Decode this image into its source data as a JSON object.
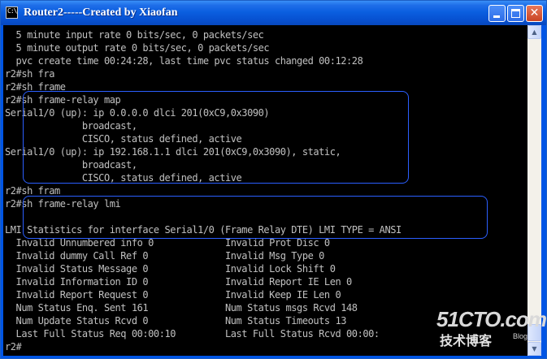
{
  "window": {
    "title": "Router2-----Created by Xiaofan",
    "icon_name": "cmd-icon",
    "icon_text": "C:\\"
  },
  "controls": {
    "minimize": "minimize",
    "maximize": "maximize",
    "close": "close"
  },
  "console": {
    "lines": [
      "  5 minute input rate 0 bits/sec, 0 packets/sec",
      "  5 minute output rate 0 bits/sec, 0 packets/sec",
      "  pvc create time 00:24:28, last time pvc status changed 00:12:28",
      "r2#sh fra",
      "r2#sh frame",
      "r2#sh frame-relay map",
      "Serial1/0 (up): ip 0.0.0.0 dlci 201(0xC9,0x3090)",
      "              broadcast,",
      "              CISCO, status defined, active",
      "Serial1/0 (up): ip 192.168.1.1 dlci 201(0xC9,0x3090), static,",
      "              broadcast,",
      "              CISCO, status defined, active",
      "r2#sh fram",
      "r2#sh frame-relay lmi",
      "",
      "LMI Statistics for interface Serial1/0 (Frame Relay DTE) LMI TYPE = ANSI",
      "  Invalid Unnumbered info 0             Invalid Prot Disc 0",
      "  Invalid dummy Call Ref 0              Invalid Msg Type 0",
      "  Invalid Status Message 0              Invalid Lock Shift 0",
      "  Invalid Information ID 0              Invalid Report IE Len 0",
      "  Invalid Report Request 0              Invalid Keep IE Len 0",
      "  Num Status Enq. Sent 161              Num Status msgs Rcvd 148",
      "  Num Update Status Rcvd 0              Num Status Timeouts 13",
      "  Last Full Status Req 00:00:10         Last Full Status Rcvd 00:00:",
      "r2#"
    ]
  },
  "watermark": {
    "main": "51CTO.com",
    "cn": "技术博客",
    "blog": "Blog"
  },
  "colors": {
    "console_text": "#c0c0c0",
    "console_bg": "#000000",
    "titlebar": "#0752d2",
    "highlight_border": "#2b5fff"
  }
}
